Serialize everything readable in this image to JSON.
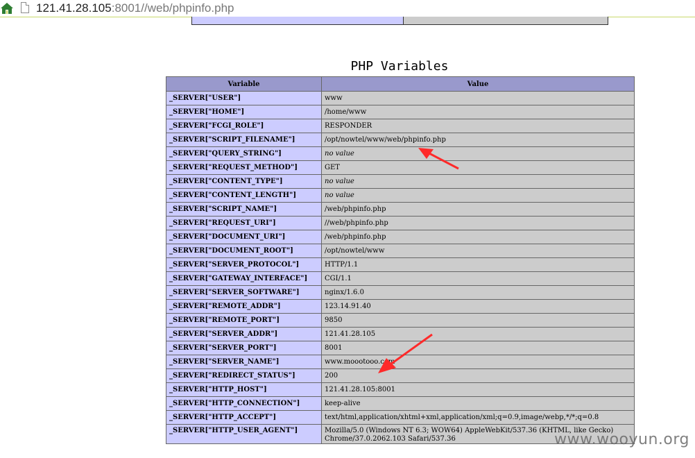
{
  "address_bar": {
    "host": "121.41.28.105",
    "rest": ":8001//web/phpinfo.php"
  },
  "section_title": "PHP Variables",
  "table": {
    "headers": [
      "Variable",
      "Value"
    ],
    "rows": [
      {
        "name": "_SERVER[\"USER\"]",
        "value": "www",
        "no_value": false
      },
      {
        "name": "_SERVER[\"HOME\"]",
        "value": "/home/www",
        "no_value": false
      },
      {
        "name": "_SERVER[\"FCGI_ROLE\"]",
        "value": "RESPONDER",
        "no_value": false
      },
      {
        "name": "_SERVER[\"SCRIPT_FILENAME\"]",
        "value": "/opt/nowtel/www/web/phpinfo.php",
        "no_value": false
      },
      {
        "name": "_SERVER[\"QUERY_STRING\"]",
        "value": "no value",
        "no_value": true
      },
      {
        "name": "_SERVER[\"REQUEST_METHOD\"]",
        "value": "GET",
        "no_value": false
      },
      {
        "name": "_SERVER[\"CONTENT_TYPE\"]",
        "value": "no value",
        "no_value": true
      },
      {
        "name": "_SERVER[\"CONTENT_LENGTH\"]",
        "value": "no value",
        "no_value": true
      },
      {
        "name": "_SERVER[\"SCRIPT_NAME\"]",
        "value": "/web/phpinfo.php",
        "no_value": false
      },
      {
        "name": "_SERVER[\"REQUEST_URI\"]",
        "value": "//web/phpinfo.php",
        "no_value": false
      },
      {
        "name": "_SERVER[\"DOCUMENT_URI\"]",
        "value": "/web/phpinfo.php",
        "no_value": false
      },
      {
        "name": "_SERVER[\"DOCUMENT_ROOT\"]",
        "value": "/opt/nowtel/www",
        "no_value": false
      },
      {
        "name": "_SERVER[\"SERVER_PROTOCOL\"]",
        "value": "HTTP/1.1",
        "no_value": false
      },
      {
        "name": "_SERVER[\"GATEWAY_INTERFACE\"]",
        "value": "CGI/1.1",
        "no_value": false
      },
      {
        "name": "_SERVER[\"SERVER_SOFTWARE\"]",
        "value": "nginx/1.6.0",
        "no_value": false
      },
      {
        "name": "_SERVER[\"REMOTE_ADDR\"]",
        "value": "123.14.91.40",
        "no_value": false
      },
      {
        "name": "_SERVER[\"REMOTE_PORT\"]",
        "value": "9850",
        "no_value": false
      },
      {
        "name": "_SERVER[\"SERVER_ADDR\"]",
        "value": "121.41.28.105",
        "no_value": false
      },
      {
        "name": "_SERVER[\"SERVER_PORT\"]",
        "value": "8001",
        "no_value": false
      },
      {
        "name": "_SERVER[\"SERVER_NAME\"]",
        "value": "www.moootooo.com",
        "no_value": false
      },
      {
        "name": "_SERVER[\"REDIRECT_STATUS\"]",
        "value": "200",
        "no_value": false
      },
      {
        "name": "_SERVER[\"HTTP_HOST\"]",
        "value": "121.41.28.105:8001",
        "no_value": false
      },
      {
        "name": "_SERVER[\"HTTP_CONNECTION\"]",
        "value": "keep-alive",
        "no_value": false
      },
      {
        "name": "_SERVER[\"HTTP_ACCEPT\"]",
        "value": "text/html,application/xhtml+xml,application/xml;q=0.9,image/webp,*/*;q=0.8",
        "no_value": false
      },
      {
        "name": "_SERVER[\"HTTP_USER_AGENT\"]",
        "value": "Mozilla/5.0 (Windows NT 6.3; WOW64) AppleWebKit/537.36 (KHTML, like Gecko) Chrome/37.0.2062.103 Safari/537.36",
        "no_value": false
      }
    ]
  },
  "watermark": "www.wooyun.org",
  "colors": {
    "header_bg": "#9999cc",
    "name_bg": "#ccccff",
    "value_bg": "#cccccc",
    "arrow": "#ff2a2a"
  },
  "icons": [
    "home-icon",
    "page-icon"
  ]
}
